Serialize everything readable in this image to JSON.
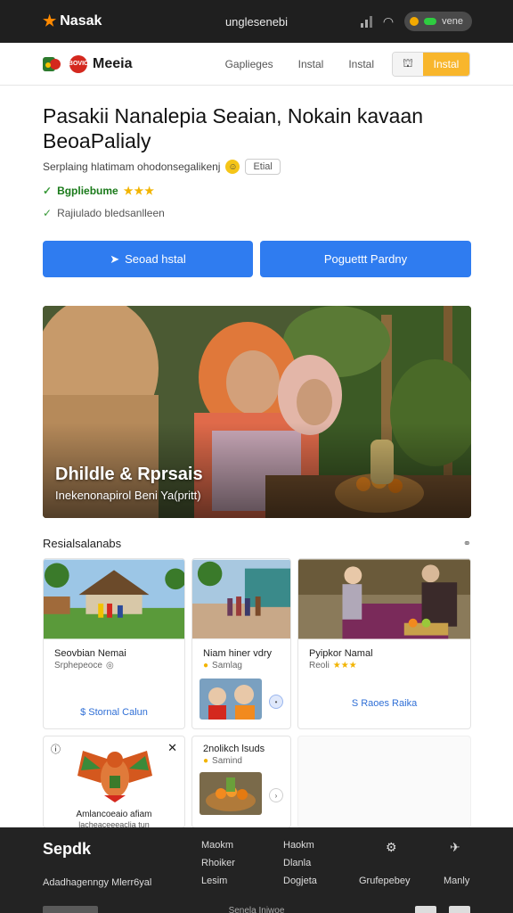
{
  "status_bar": {
    "brand": "Nasak",
    "center_text": "unglesenebi",
    "pill_text": "vene"
  },
  "header": {
    "logo_text": "Meeia",
    "logo_badge": "BOVIC",
    "nav": [
      "Gaplieges",
      "Instal",
      "Instal"
    ],
    "install_label": "Instal"
  },
  "hero_text": {
    "title": "Pasakii Nanalepia Seaian, Nokain kavaan BeoaPalialy",
    "subline": "Serplaing hlatimam ohodonsegalikenj",
    "subline_tag": "Etial",
    "meta1": "Bgpliebume",
    "meta1_stars": "★★★",
    "meta2": "Rajiulado bledsanlleen"
  },
  "cta": {
    "primary": "Seoad hstal",
    "secondary": "Poguettt Pardny"
  },
  "hero_image": {
    "heading": "Dhildle & Rprsais",
    "subheading": "Inekenonapirol Beni Ya(pritt)"
  },
  "section": {
    "title": "Resialsalanabs",
    "link_icon": "link-icon"
  },
  "cards": [
    {
      "name": "Seovbian Nemai",
      "sub": "Srphepeoce",
      "link": "$ Stornal Calun"
    },
    {
      "name": "Niam hiner vdry",
      "sub": "Samlag"
    },
    {
      "name": "Pyipkor Namal",
      "sub": "Reoli",
      "stars": "★★★",
      "link": "S Raoes Raika"
    },
    {
      "name": "Amlancoeaio afiam",
      "sub": "lacheaceeeaclia tun"
    },
    {
      "name": "2nolikch lsuds",
      "sub": "Samind"
    }
  ],
  "footer": {
    "logo": "Sepdk",
    "tagline": "Adadhagenngy Mlerr6yal",
    "col1": [
      "Maokm",
      "Rhoiker",
      "Lesim"
    ],
    "col2": [
      "Haokm",
      "Dlanla",
      "Dogjeta"
    ],
    "col3": "Grufepebey",
    "col4": "Manly",
    "bottom_text": "Senela Iniwoe"
  }
}
